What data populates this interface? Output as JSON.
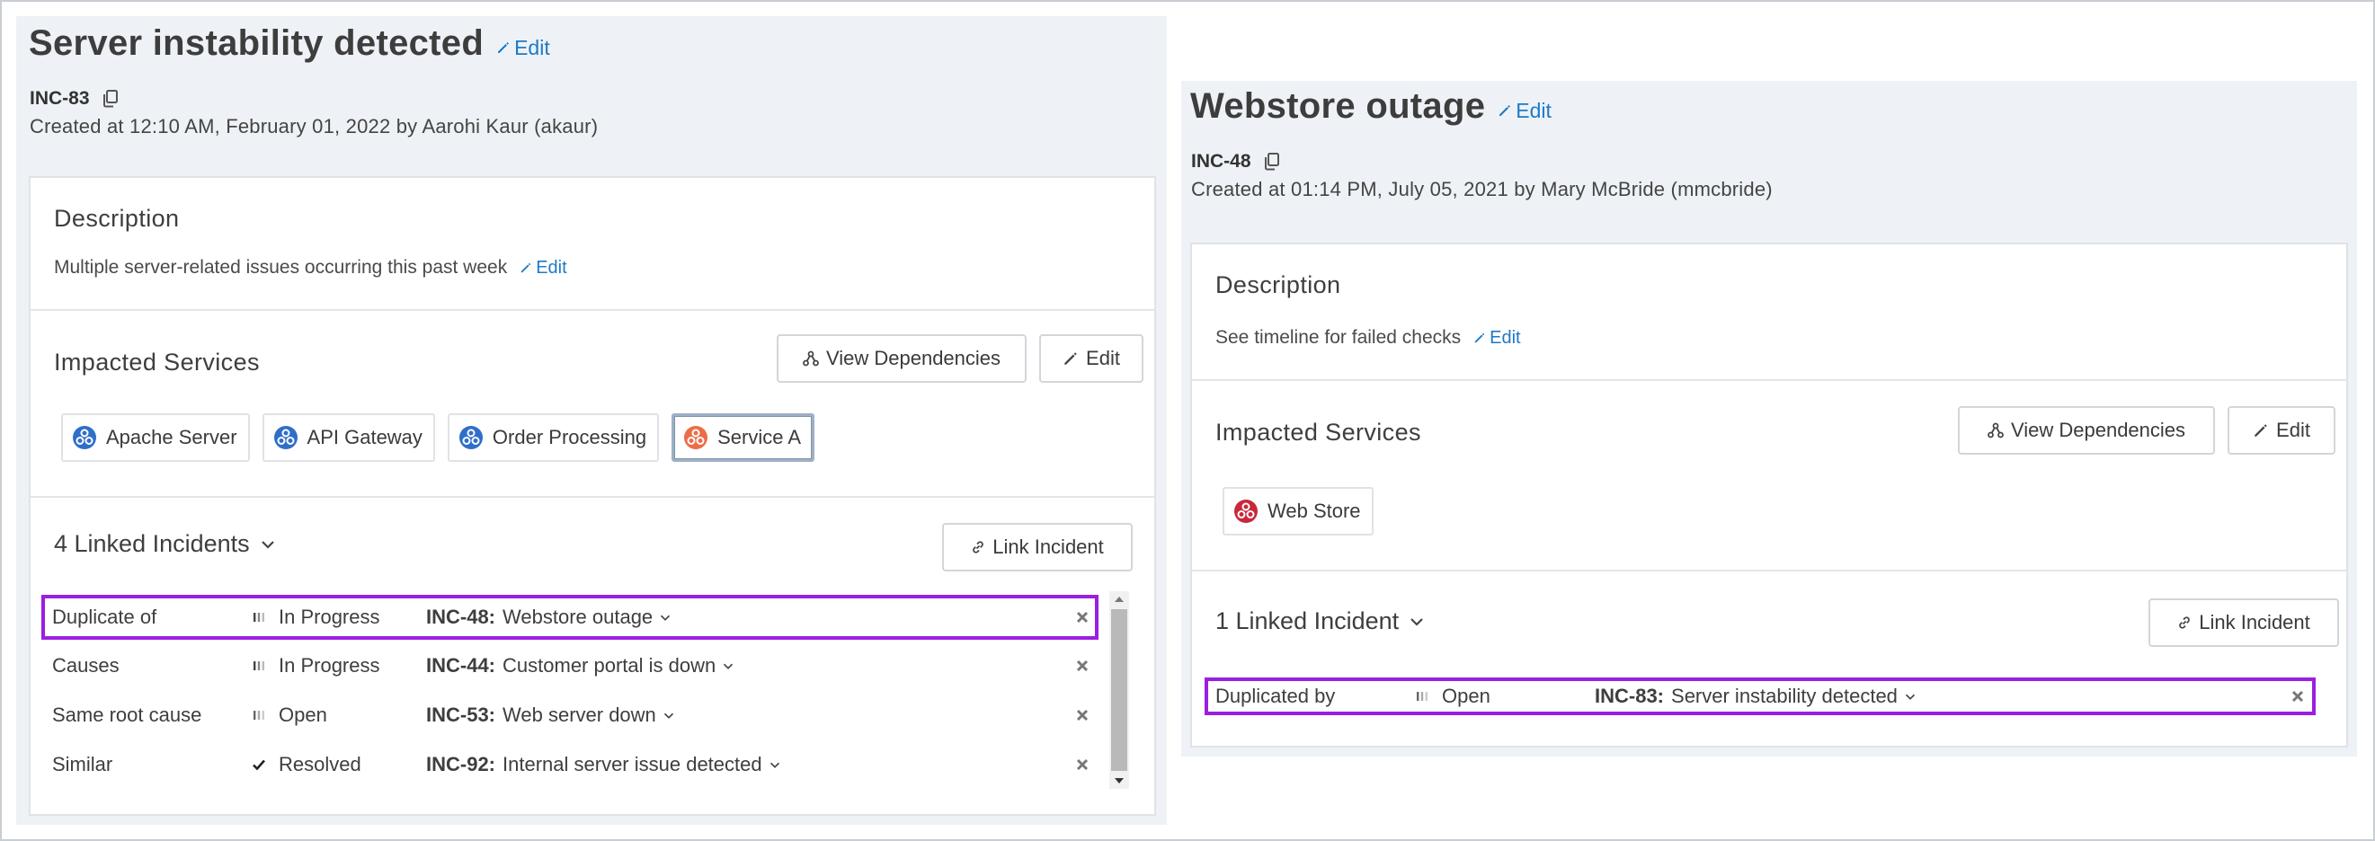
{
  "left": {
    "title": "Server instability detected",
    "title_edit": "Edit",
    "incident_id": "INC-83",
    "created": "Created at 12:10 AM, February 01, 2022 by Aarohi Kaur (akaur)",
    "description": {
      "heading": "Description",
      "text": "Multiple server-related issues occurring this past week",
      "edit": "Edit"
    },
    "impacted": {
      "heading": "Impacted Services",
      "view_dependencies": "View Dependencies",
      "edit": "Edit",
      "services": [
        {
          "name": "Apache Server",
          "color": "#2f6fc9"
        },
        {
          "name": "API Gateway",
          "color": "#2f6fc9"
        },
        {
          "name": "Order Processing",
          "color": "#2f6fc9"
        },
        {
          "name": "Service A",
          "color": "#ec6d49"
        }
      ]
    },
    "linked": {
      "heading": "4 Linked Incidents",
      "link_button": "Link Incident",
      "rows": [
        {
          "relation": "Duplicate of",
          "status": "In Progress",
          "key": "INC-48:",
          "name": "Webstore outage"
        },
        {
          "relation": "Causes",
          "status": "In Progress",
          "key": "INC-44:",
          "name": "Customer portal is down"
        },
        {
          "relation": "Same root cause",
          "status": "Open",
          "key": "INC-53:",
          "name": "Web server down"
        },
        {
          "relation": "Similar",
          "status": "Resolved",
          "key": "INC-92:",
          "name": "Internal server issue detected"
        }
      ]
    }
  },
  "right": {
    "title": "Webstore outage",
    "title_edit": "Edit",
    "incident_id": "INC-48",
    "created": "Created at 01:14 PM, July 05, 2021 by Mary McBride (mmcbride)",
    "description": {
      "heading": "Description",
      "text": "See timeline for failed checks",
      "edit": "Edit"
    },
    "impacted": {
      "heading": "Impacted Services",
      "view_dependencies": "View Dependencies",
      "edit": "Edit",
      "services": [
        {
          "name": "Web Store",
          "color": "#c8283a"
        }
      ]
    },
    "linked": {
      "heading": "1 Linked Incident",
      "link_button": "Link Incident",
      "rows": [
        {
          "relation": "Duplicated by",
          "status": "Open",
          "key": "INC-83:",
          "name": "Server instability detected"
        }
      ]
    }
  },
  "colors": {
    "accent_link": "#1d7ac7",
    "highlight": "#9b1fe0",
    "panel_bg": "#eef2f6"
  }
}
